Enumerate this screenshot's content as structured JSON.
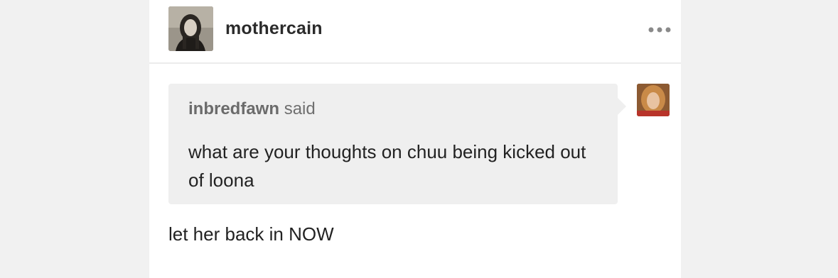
{
  "post": {
    "blog_name": "mothercain",
    "more_icon": "more-horizontal-icon",
    "ask": {
      "asker": "inbredfawn",
      "said_label": "said",
      "question": "what are your thoughts on chuu being kicked out of loona"
    },
    "answer": "let her back in NOW"
  },
  "colors": {
    "card_background": "#ffffff",
    "page_background": "#f1f1f1",
    "ask_bubble": "#efefef",
    "text_primary": "#222222",
    "text_secondary": "#6f6f6f"
  }
}
